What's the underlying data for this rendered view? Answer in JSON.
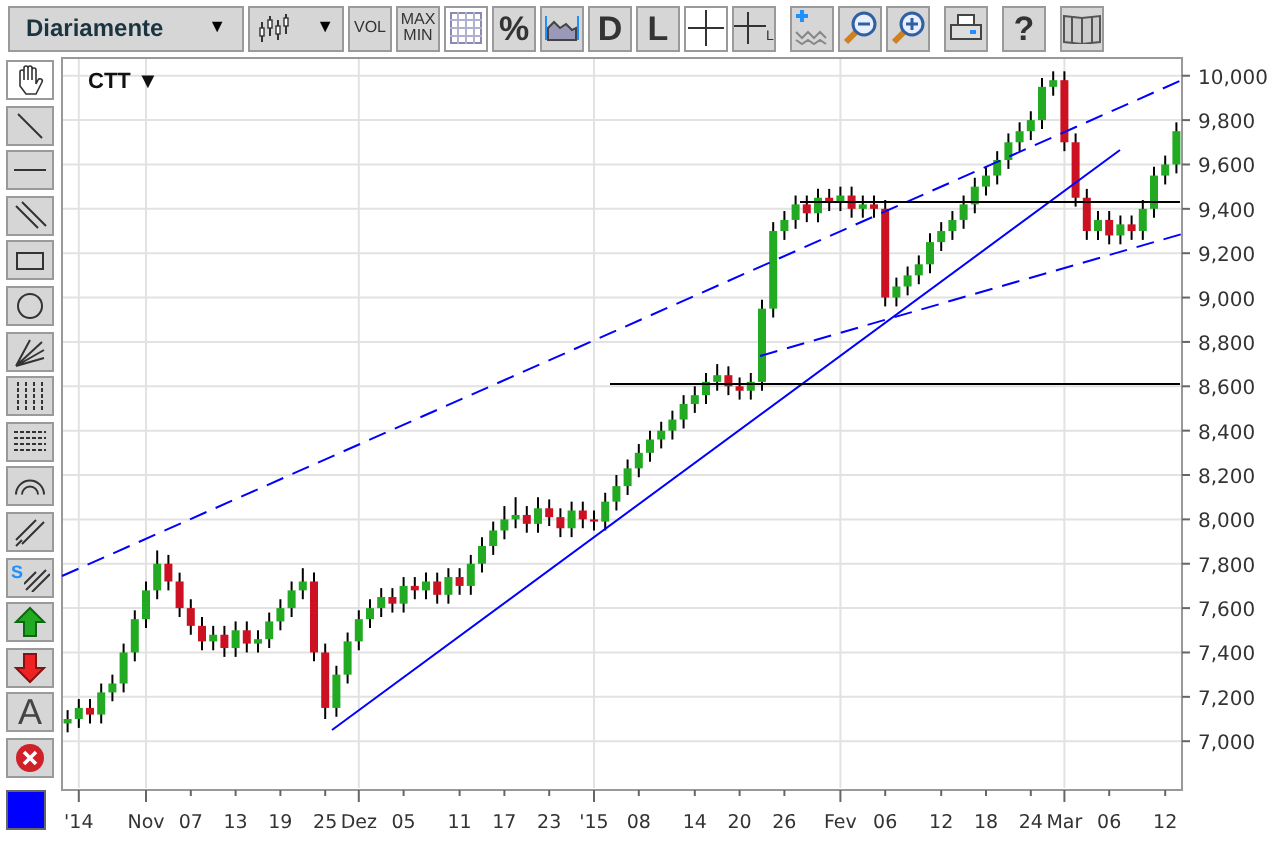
{
  "toolbar": {
    "period": {
      "label": "Diariamente",
      "caret": "▼"
    },
    "chart_type": {
      "caret": "▼"
    },
    "buttons": [
      {
        "kind": "text",
        "label": "VOL",
        "selected": false
      },
      {
        "kind": "stacked",
        "lines": [
          "MAX",
          "MIN"
        ],
        "selected": false
      },
      {
        "kind": "grid",
        "selected": true
      },
      {
        "kind": "big",
        "label": "%",
        "selected": false
      },
      {
        "kind": "area",
        "selected": false
      },
      {
        "kind": "big",
        "label": "D",
        "selected": false
      },
      {
        "kind": "big",
        "label": "L",
        "selected": false
      },
      {
        "kind": "crosshair",
        "selected": true
      },
      {
        "kind": "crosshair-sub",
        "label": "L",
        "selected": false
      },
      {
        "kind": "add-line",
        "selected": false
      },
      {
        "kind": "zoom-out",
        "selected": false
      },
      {
        "kind": "zoom-in",
        "selected": false
      },
      {
        "kind": "print",
        "selected": false
      },
      {
        "kind": "big",
        "label": "?",
        "selected": false
      },
      {
        "kind": "book",
        "selected": false
      }
    ]
  },
  "tools": [
    {
      "kind": "hand",
      "selected": true
    },
    {
      "kind": "diagonal",
      "selected": false
    },
    {
      "kind": "horizontal",
      "selected": false
    },
    {
      "kind": "parallel",
      "selected": false
    },
    {
      "kind": "rectangle",
      "selected": false
    },
    {
      "kind": "circle",
      "selected": false
    },
    {
      "kind": "fan",
      "selected": false
    },
    {
      "kind": "vgrid",
      "selected": false
    },
    {
      "kind": "hgrid",
      "selected": false
    },
    {
      "kind": "arc",
      "selected": false
    },
    {
      "kind": "channel",
      "selected": false
    },
    {
      "kind": "channel-s",
      "label": "S",
      "selected": false
    },
    {
      "kind": "arrow-up",
      "selected": false
    },
    {
      "kind": "arrow-down",
      "selected": false
    },
    {
      "kind": "text",
      "label": "A",
      "selected": false
    },
    {
      "kind": "delete",
      "selected": false
    }
  ],
  "line_color": {
    "color": "#0000ff"
  },
  "chart": {
    "symbol": "CTT",
    "caret": "▼",
    "chart_data": {
      "type": "candlestick",
      "categories": [
        null,
        "'14",
        null,
        null,
        null,
        null,
        null,
        "Nov",
        null,
        null,
        null,
        "07",
        null,
        null,
        null,
        "13",
        null,
        null,
        null,
        "19",
        null,
        null,
        null,
        "25",
        null,
        null,
        "Dez",
        null,
        null,
        null,
        "05",
        null,
        null,
        null,
        null,
        "11",
        null,
        null,
        null,
        "17",
        null,
        null,
        null,
        "23",
        null,
        null,
        null,
        "'15",
        null,
        null,
        null,
        "08",
        null,
        null,
        null,
        null,
        "14",
        null,
        null,
        null,
        "20",
        null,
        null,
        null,
        "26",
        null,
        null,
        null,
        null,
        "Fev",
        null,
        null,
        null,
        "06",
        null,
        null,
        null,
        null,
        "12",
        null,
        null,
        null,
        "18",
        null,
        null,
        null,
        "24",
        null,
        null,
        "Mar",
        null,
        null,
        null,
        "06",
        null,
        null,
        null,
        null,
        "12",
        null
      ],
      "ohlc": [
        [
          7080,
          7140,
          7040,
          7100
        ],
        [
          7100,
          7190,
          7060,
          7150
        ],
        [
          7150,
          7190,
          7080,
          7120
        ],
        [
          7120,
          7260,
          7080,
          7220
        ],
        [
          7220,
          7300,
          7180,
          7260
        ],
        [
          7260,
          7440,
          7220,
          7400
        ],
        [
          7400,
          7590,
          7360,
          7550
        ],
        [
          7550,
          7720,
          7510,
          7680
        ],
        [
          7680,
          7860,
          7640,
          7800
        ],
        [
          7800,
          7840,
          7680,
          7720
        ],
        [
          7720,
          7760,
          7560,
          7600
        ],
        [
          7600,
          7640,
          7480,
          7520
        ],
        [
          7520,
          7560,
          7410,
          7450
        ],
        [
          7450,
          7520,
          7410,
          7480
        ],
        [
          7480,
          7520,
          7380,
          7420
        ],
        [
          7420,
          7540,
          7380,
          7500
        ],
        [
          7500,
          7540,
          7400,
          7440
        ],
        [
          7440,
          7500,
          7400,
          7460
        ],
        [
          7460,
          7580,
          7420,
          7540
        ],
        [
          7540,
          7640,
          7500,
          7600
        ],
        [
          7600,
          7720,
          7560,
          7680
        ],
        [
          7680,
          7780,
          7640,
          7720
        ],
        [
          7720,
          7760,
          7360,
          7400
        ],
        [
          7400,
          7440,
          7100,
          7150
        ],
        [
          7150,
          7340,
          7110,
          7300
        ],
        [
          7300,
          7490,
          7260,
          7450
        ],
        [
          7450,
          7590,
          7410,
          7550
        ],
        [
          7550,
          7640,
          7510,
          7600
        ],
        [
          7600,
          7690,
          7560,
          7650
        ],
        [
          7650,
          7690,
          7580,
          7620
        ],
        [
          7620,
          7740,
          7580,
          7700
        ],
        [
          7700,
          7740,
          7640,
          7680
        ],
        [
          7680,
          7760,
          7640,
          7720
        ],
        [
          7720,
          7760,
          7620,
          7660
        ],
        [
          7660,
          7780,
          7620,
          7740
        ],
        [
          7740,
          7780,
          7660,
          7700
        ],
        [
          7700,
          7840,
          7660,
          7800
        ],
        [
          7800,
          7920,
          7760,
          7880
        ],
        [
          7880,
          7990,
          7840,
          7950
        ],
        [
          7950,
          8060,
          7910,
          8000
        ],
        [
          8000,
          8100,
          7960,
          8020
        ],
        [
          8020,
          8060,
          7940,
          7980
        ],
        [
          7980,
          8100,
          7940,
          8050
        ],
        [
          8050,
          8090,
          7970,
          8010
        ],
        [
          8010,
          8050,
          7920,
          7960
        ],
        [
          7960,
          8080,
          7920,
          8040
        ],
        [
          8040,
          8080,
          7960,
          8000
        ],
        [
          8000,
          8040,
          7950,
          7990
        ],
        [
          7990,
          8120,
          7950,
          8080
        ],
        [
          8080,
          8200,
          8040,
          8150
        ],
        [
          8150,
          8270,
          8110,
          8230
        ],
        [
          8230,
          8340,
          8190,
          8300
        ],
        [
          8300,
          8400,
          8260,
          8360
        ],
        [
          8360,
          8440,
          8320,
          8400
        ],
        [
          8400,
          8490,
          8360,
          8450
        ],
        [
          8450,
          8560,
          8410,
          8520
        ],
        [
          8520,
          8600,
          8480,
          8560
        ],
        [
          8560,
          8660,
          8520,
          8620
        ],
        [
          8620,
          8700,
          8580,
          8650
        ],
        [
          8650,
          8690,
          8560,
          8600
        ],
        [
          8600,
          8640,
          8540,
          8580
        ],
        [
          8580,
          8660,
          8540,
          8620
        ],
        [
          8620,
          8990,
          8580,
          8950
        ],
        [
          8950,
          9340,
          8910,
          9300
        ],
        [
          9300,
          9390,
          9260,
          9350
        ],
        [
          9350,
          9460,
          9310,
          9420
        ],
        [
          9420,
          9460,
          9340,
          9380
        ],
        [
          9380,
          9490,
          9340,
          9450
        ],
        [
          9450,
          9490,
          9390,
          9430
        ],
        [
          9430,
          9500,
          9390,
          9460
        ],
        [
          9460,
          9500,
          9360,
          9400
        ],
        [
          9400,
          9460,
          9360,
          9420
        ],
        [
          9420,
          9460,
          9360,
          9400
        ],
        [
          9400,
          9440,
          8960,
          9000
        ],
        [
          9000,
          9090,
          8960,
          9050
        ],
        [
          9050,
          9140,
          9010,
          9100
        ],
        [
          9100,
          9190,
          9060,
          9150
        ],
        [
          9150,
          9290,
          9110,
          9250
        ],
        [
          9250,
          9340,
          9210,
          9300
        ],
        [
          9300,
          9390,
          9260,
          9350
        ],
        [
          9350,
          9460,
          9310,
          9420
        ],
        [
          9420,
          9540,
          9380,
          9500
        ],
        [
          9500,
          9590,
          9460,
          9550
        ],
        [
          9550,
          9660,
          9510,
          9620
        ],
        [
          9620,
          9740,
          9580,
          9700
        ],
        [
          9700,
          9790,
          9660,
          9750
        ],
        [
          9750,
          9840,
          9710,
          9800
        ],
        [
          9800,
          9990,
          9760,
          9950
        ],
        [
          9950,
          10020,
          9910,
          9980
        ],
        [
          9980,
          10020,
          9660,
          9700
        ],
        [
          9700,
          9740,
          9410,
          9450
        ],
        [
          9450,
          9490,
          9260,
          9300
        ],
        [
          9300,
          9390,
          9260,
          9350
        ],
        [
          9350,
          9390,
          9240,
          9280
        ],
        [
          9280,
          9370,
          9240,
          9330
        ],
        [
          9330,
          9370,
          9260,
          9300
        ],
        [
          9300,
          9440,
          9260,
          9400
        ],
        [
          9400,
          9590,
          9360,
          9550
        ],
        [
          9550,
          9640,
          9510,
          9600
        ],
        [
          9600,
          9790,
          9560,
          9750
        ]
      ],
      "ylim": [
        6780,
        10080
      ],
      "grid": true,
      "yticks": [
        {
          "value": 10000,
          "label": "10,000"
        },
        {
          "value": 9800,
          "label": "9,800"
        },
        {
          "value": 9600,
          "label": "9,600"
        },
        {
          "value": 9400,
          "label": "9,400"
        },
        {
          "value": 9200,
          "label": "9,200"
        },
        {
          "value": 9000,
          "label": "9,000"
        },
        {
          "value": 8800,
          "label": "8,800"
        },
        {
          "value": 8600,
          "label": "8,600"
        },
        {
          "value": 8400,
          "label": "8,400"
        },
        {
          "value": 8200,
          "label": "8,200"
        },
        {
          "value": 8000,
          "label": "8,000"
        },
        {
          "value": 7800,
          "label": "7,800"
        },
        {
          "value": 7600,
          "label": "7,600"
        },
        {
          "value": 7400,
          "label": "7,400"
        },
        {
          "value": 7200,
          "label": "7,200"
        },
        {
          "value": 7000,
          "label": "7,000"
        }
      ]
    }
  }
}
